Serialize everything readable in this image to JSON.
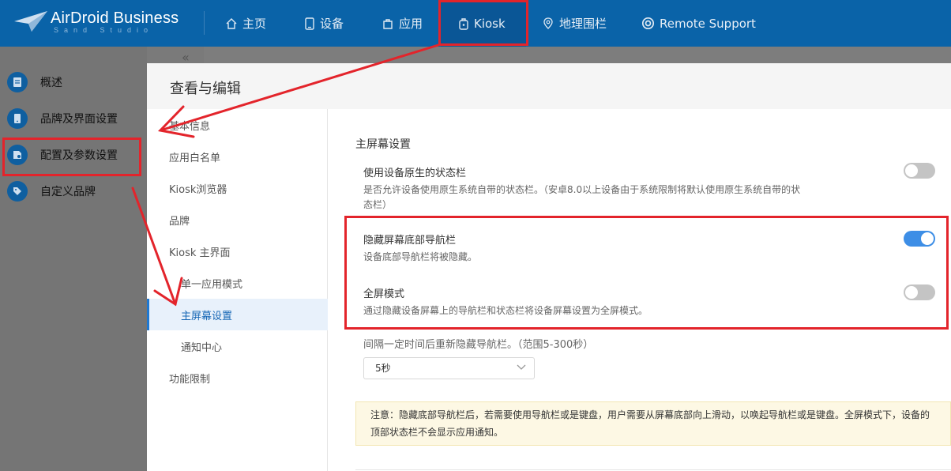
{
  "brand": {
    "title": "AirDroid Business",
    "subtitle": "Sand Studio"
  },
  "topnav": {
    "items": [
      {
        "label": "主页",
        "icon": "home-icon"
      },
      {
        "label": "设备",
        "icon": "device-icon"
      },
      {
        "label": "应用",
        "icon": "app-icon"
      },
      {
        "label": "Kiosk",
        "icon": "kiosk-icon"
      },
      {
        "label": "地理围栏",
        "icon": "geofence-icon"
      },
      {
        "label": "Remote Support",
        "icon": "lifebuoy-icon"
      }
    ],
    "active": "Kiosk"
  },
  "sidebar": {
    "collapse_label": "«",
    "items": [
      {
        "label": "概述",
        "icon": "overview-icon"
      },
      {
        "label": "品牌及界面设置",
        "icon": "brand-ui-icon"
      },
      {
        "label": "配置及参数设置",
        "icon": "config-icon"
      },
      {
        "label": "自定义品牌",
        "icon": "tag-icon"
      }
    ],
    "active": "配置及参数设置"
  },
  "dialog": {
    "title": "查看与编辑",
    "nav": [
      {
        "label": "基本信息",
        "level": 1
      },
      {
        "label": "应用白名单",
        "level": 1
      },
      {
        "label": "Kiosk浏览器",
        "level": 1
      },
      {
        "label": "品牌",
        "level": 1
      },
      {
        "label": "Kiosk 主界面",
        "level": 1
      },
      {
        "label": "单一应用模式",
        "level": 2
      },
      {
        "label": "主屏幕设置",
        "level": 2
      },
      {
        "label": "通知中心",
        "level": 2
      },
      {
        "label": "功能限制",
        "level": 1
      }
    ],
    "active_nav": "主屏幕设置",
    "section_title": "主屏幕设置",
    "options": [
      {
        "title": "使用设备原生的状态栏",
        "desc": "是否允许设备使用原生系统自带的状态栏。（安卓8.0以上设备由于系统限制将默认使用原生系统自带的状态栏）",
        "enabled": false
      },
      {
        "title": "隐藏屏幕底部导航栏",
        "desc": "设备底部导航栏将被隐藏。",
        "enabled": true
      },
      {
        "title": "全屏模式",
        "desc": "通过隐藏设备屏幕上的导航栏和状态栏将设备屏幕设置为全屏模式。",
        "enabled": false
      }
    ],
    "interval": {
      "label": "间隔一定时间后重新隐藏导航栏。（范围5-300秒）",
      "value": "5秒"
    },
    "note": "注意：隐藏底部导航栏后，若需要使用导航栏或是键盘，用户需要从屏幕底部向上滑动，以唤起导航栏或是键盘。全屏模式下，设备的顶部状态栏不会显示应用通知。"
  },
  "colors": {
    "topbar": "#0a63a8",
    "accent": "#3d8ee6",
    "highlight": "#e3242b",
    "note_bg": "#fdf8e4"
  }
}
